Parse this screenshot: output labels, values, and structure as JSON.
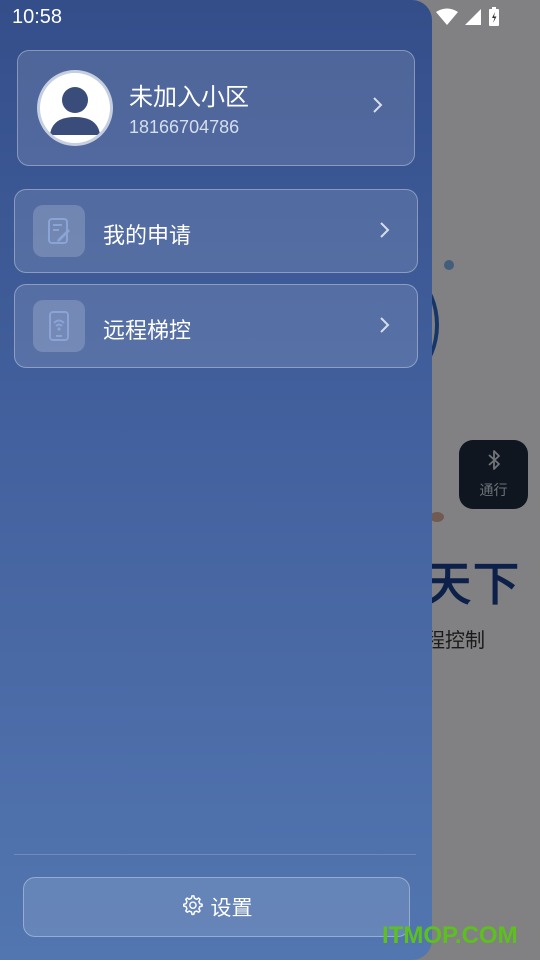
{
  "status_bar": {
    "time": "10:58"
  },
  "background_app": {
    "pass_button_label": "通行",
    "brand_fragment": "天下",
    "subtitle_fragment": "程控制"
  },
  "drawer": {
    "profile": {
      "name": "未加入小区",
      "phone": "18166704786"
    },
    "menu": [
      {
        "label": "我的申请",
        "icon": "edit-document-icon"
      },
      {
        "label": "远程梯控",
        "icon": "phone-wifi-icon"
      }
    ],
    "settings_label": "设置"
  },
  "watermark": "ITMOP.COM"
}
